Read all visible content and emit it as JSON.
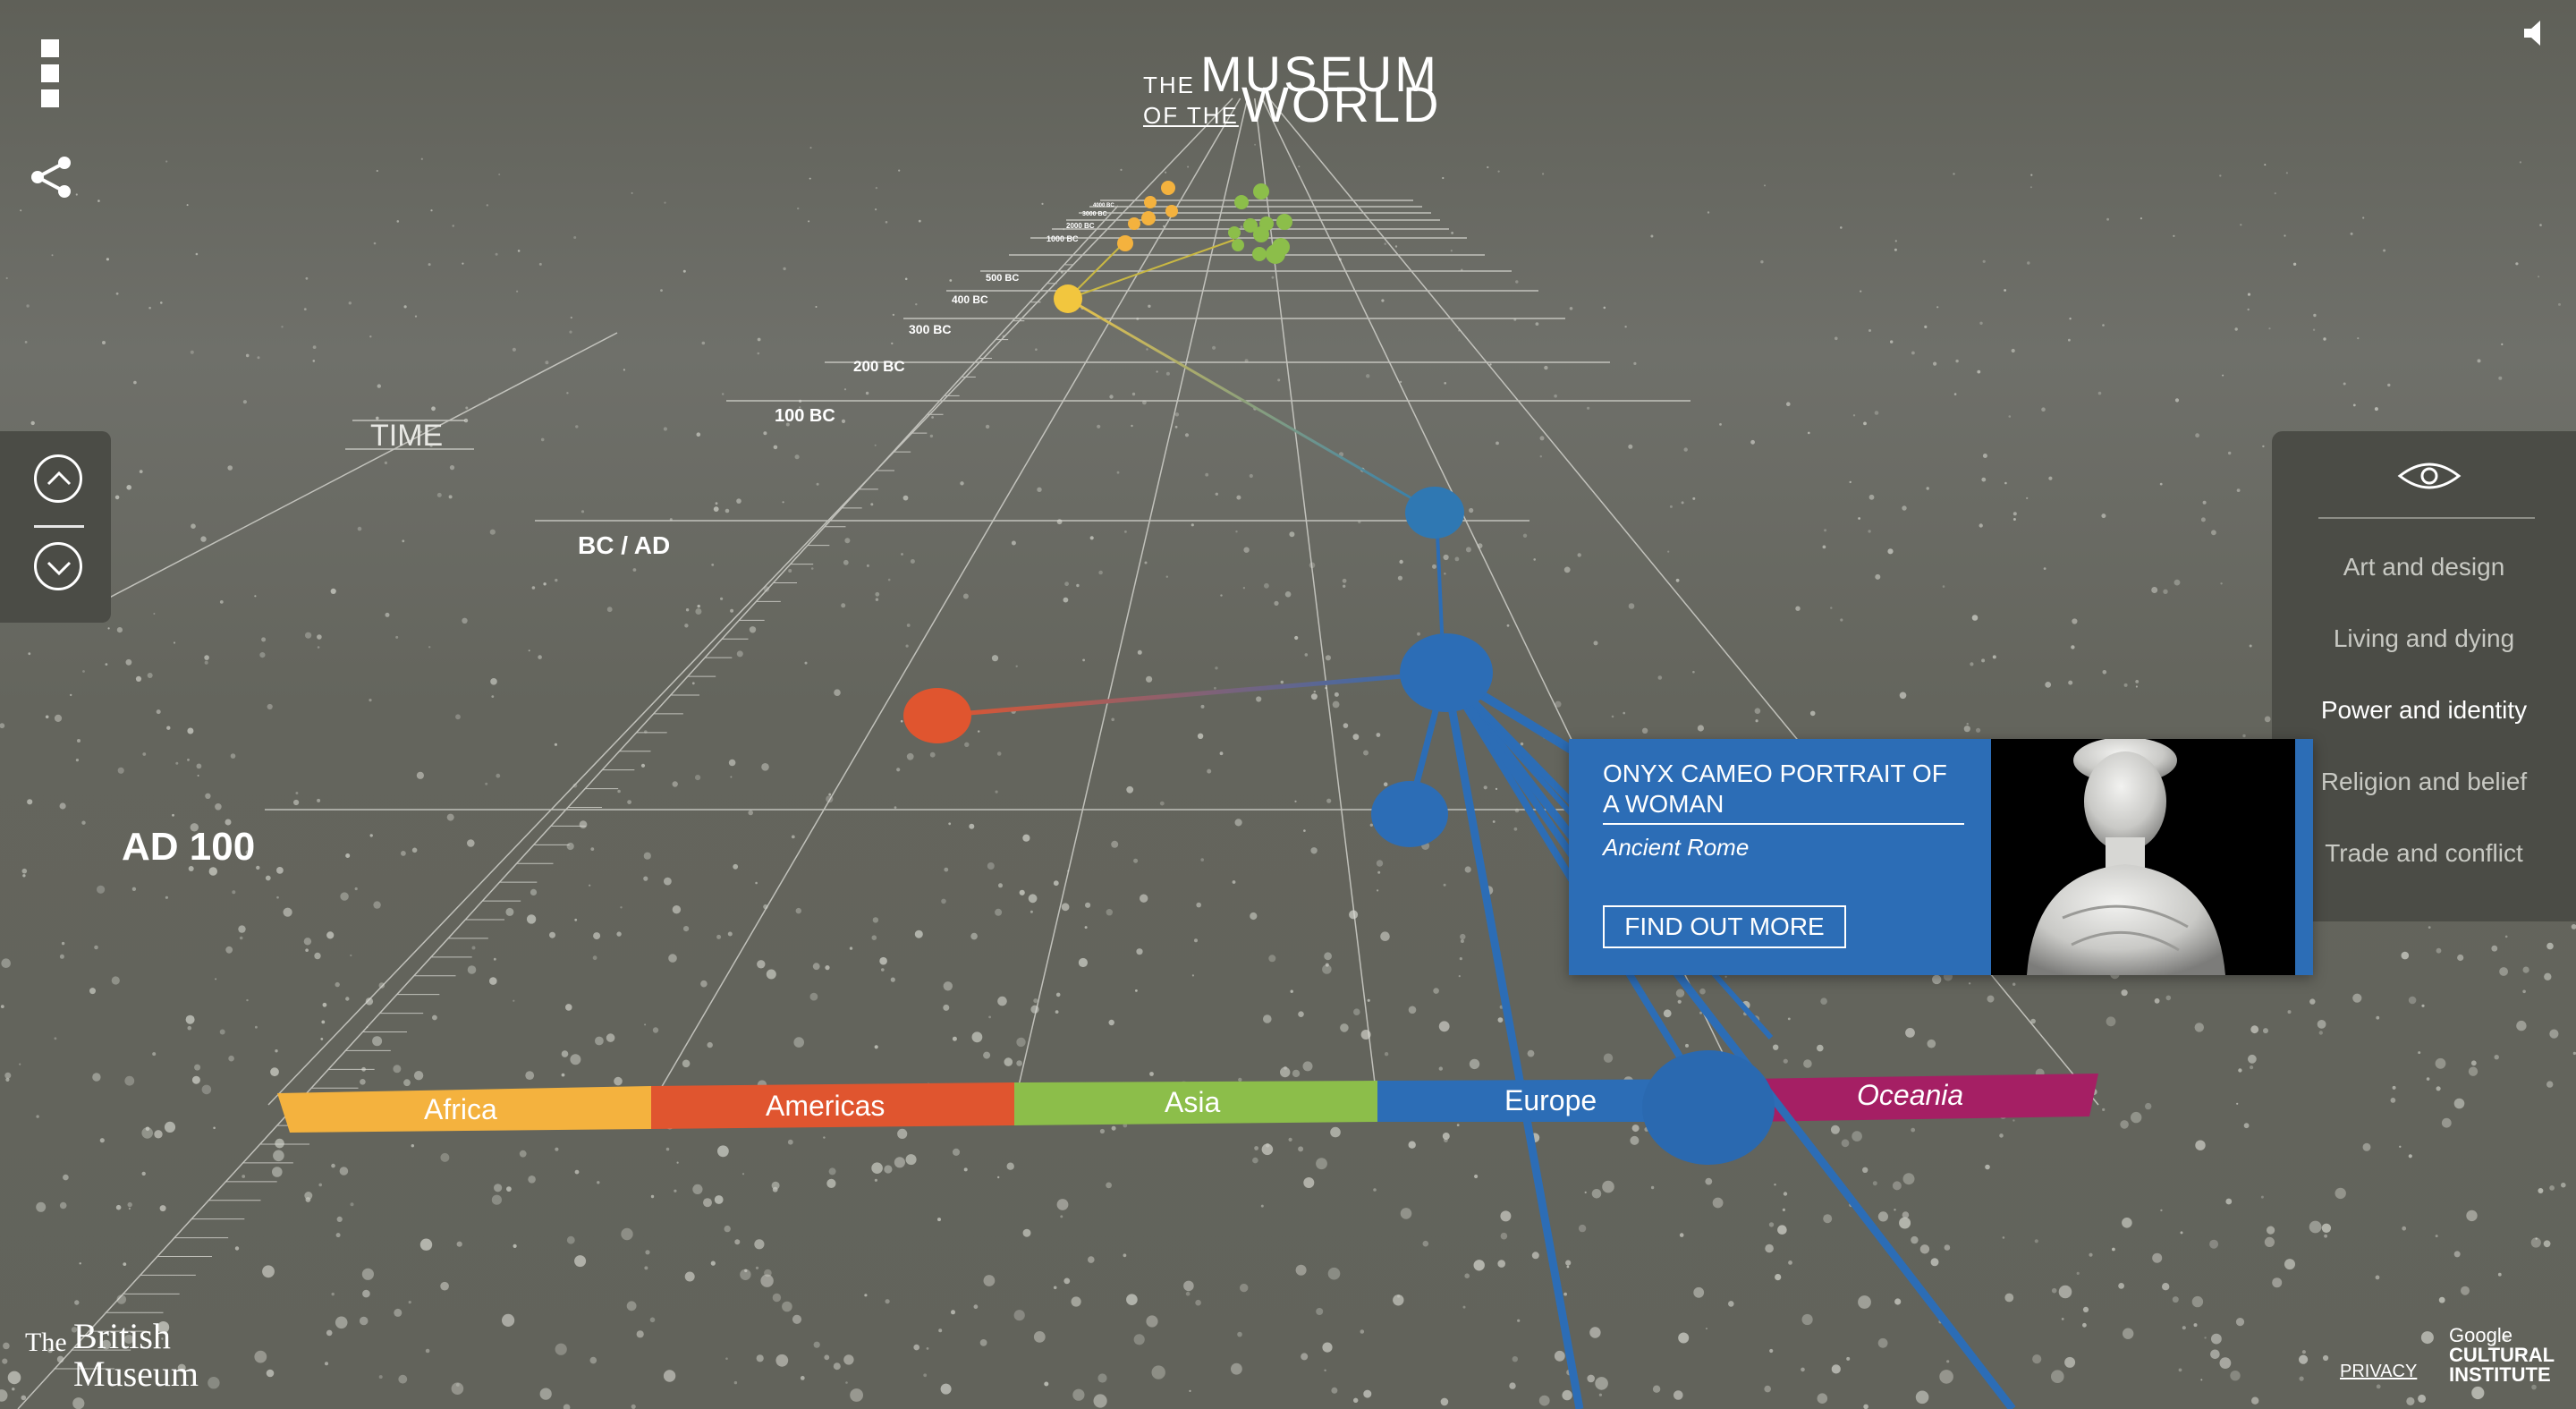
{
  "header": {
    "logo_the": "THE",
    "logo_museum": "MUSEUM",
    "logo_of_the": "OF THE",
    "logo_world": "WORLD"
  },
  "icons": {
    "menu": "menu-icon",
    "share": "share-icon",
    "sound": "speaker-icon",
    "eye": "eye-icon",
    "up": "chevron-up-icon",
    "down": "chevron-down-icon"
  },
  "timeline": {
    "axis_label": "TIME",
    "era_label": "BC / AD",
    "current_date": "AD 100",
    "date_labels": [
      "100 BC",
      "200 BC",
      "300 BC",
      "400 BC",
      "500 BC",
      "1000 BC",
      "2000 BC",
      "3000 BC",
      "4000 BC"
    ]
  },
  "regions": [
    {
      "name": "Africa",
      "color": "#f4b23e"
    },
    {
      "name": "Americas",
      "color": "#e0552f"
    },
    {
      "name": "Asia",
      "color": "#8cbe4a"
    },
    {
      "name": "Europe",
      "color": "#2c6db6"
    },
    {
      "name": "Oceania",
      "color": "#a51f64"
    }
  ],
  "filters": {
    "items": [
      "Art and design",
      "Living and dying",
      "Power and identity",
      "Religion and belief",
      "Trade and conflict"
    ],
    "active": "Power and identity"
  },
  "card": {
    "title": "ONYX CAMEO PORTRAIT OF A WOMAN",
    "subtitle": "Ancient Rome",
    "button": "FIND OUT MORE"
  },
  "footer": {
    "bm_the": "The",
    "bm_british": "British",
    "bm_museum": "Museum",
    "privacy": "PRIVACY",
    "google": "Google",
    "cultural": "CULTURAL",
    "institute": "INSTITUTE"
  },
  "colors": {
    "background": "#64655d",
    "panel": "#4b4c46",
    "europe_blue": "#2c6db6"
  }
}
